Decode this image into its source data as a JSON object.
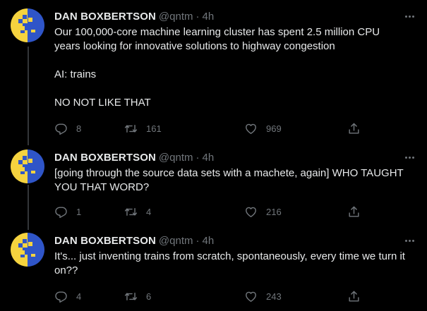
{
  "tweets": [
    {
      "name": "DAN BOXBERTSON",
      "handle": "@qntm",
      "separator": "·",
      "time": "4h",
      "lines": [
        "Our 100,000-core machine learning cluster has spent 2.5 million CPU years looking for innovative solutions to highway congestion",
        "AI: trains",
        "NO NOT LIKE THAT"
      ],
      "replies": "8",
      "retweets": "161",
      "likes": "969"
    },
    {
      "name": "DAN BOXBERTSON",
      "handle": "@qntm",
      "separator": "·",
      "time": "4h",
      "lines": [
        "[going through the source data sets with a machete, again] WHO TAUGHT YOU THAT WORD?"
      ],
      "replies": "1",
      "retweets": "4",
      "likes": "216"
    },
    {
      "name": "DAN BOXBERTSON",
      "handle": "@qntm",
      "separator": "·",
      "time": "4h",
      "lines": [
        "It's... just inventing trains from scratch, spontaneously, every time we turn it on??"
      ],
      "replies": "4",
      "retweets": "6",
      "likes": "243"
    }
  ],
  "icons": {
    "more": "more-options-icon",
    "reply": "reply-icon",
    "retweet": "retweet-icon",
    "like": "heart-icon",
    "share": "share-icon"
  },
  "colors": {
    "background": "#000000",
    "text": "#e7e9ea",
    "muted": "#71767b",
    "thread_line": "#333639",
    "avatar_yellow": "#f5d33f",
    "avatar_blue": "#2f55c8"
  }
}
